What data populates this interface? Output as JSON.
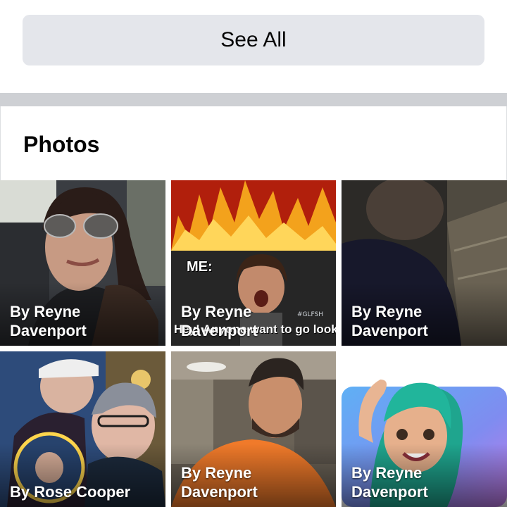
{
  "see_all": {
    "label": "See All"
  },
  "photos_section": {
    "title": "Photos",
    "items": [
      {
        "caption": [
          "By Reyne",
          "Davenport"
        ]
      },
      {
        "caption": [
          "By Reyne",
          "Davenport"
        ],
        "meme_top": "ME:",
        "meme_bottom": "Hey! Anyone want to go look for Rocks?",
        "meme_tag": "#GLFSH"
      },
      {
        "caption": [
          "By Reyne",
          "Davenport"
        ]
      },
      {
        "caption": [
          "By Rose Cooper"
        ]
      },
      {
        "caption": [
          "By Reyne",
          "Davenport"
        ]
      },
      {
        "caption": [
          "By Reyne",
          "Davenport"
        ]
      }
    ]
  },
  "colors": {
    "button_bg": "#e4e6eb",
    "divider": "#ced0d4",
    "text": "#050505"
  }
}
